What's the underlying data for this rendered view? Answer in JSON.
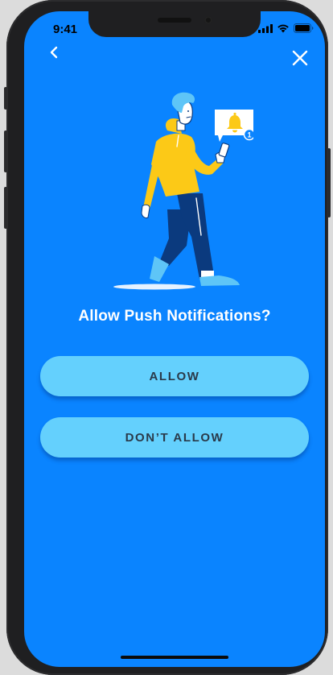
{
  "status_bar": {
    "time": "9:41",
    "icons": [
      "signal-icon",
      "wifi-icon",
      "battery-icon"
    ]
  },
  "nav": {
    "back_icon": "chevron-left-icon",
    "close_icon": "close-icon"
  },
  "illustration": {
    "description_icon": "person-with-phone-notification-illustration",
    "badge_count": "1"
  },
  "dialog": {
    "title": "Allow Push Notifications?",
    "allow_label": "ALLOW",
    "deny_label": "DON’T ALLOW"
  },
  "colors": {
    "background": "#0a84ff",
    "button": "#64d0fd",
    "button_text": "#2a3a4a",
    "title_text": "#ffffff",
    "hoodie": "#fcc917",
    "pants": "#0b3a7e"
  }
}
